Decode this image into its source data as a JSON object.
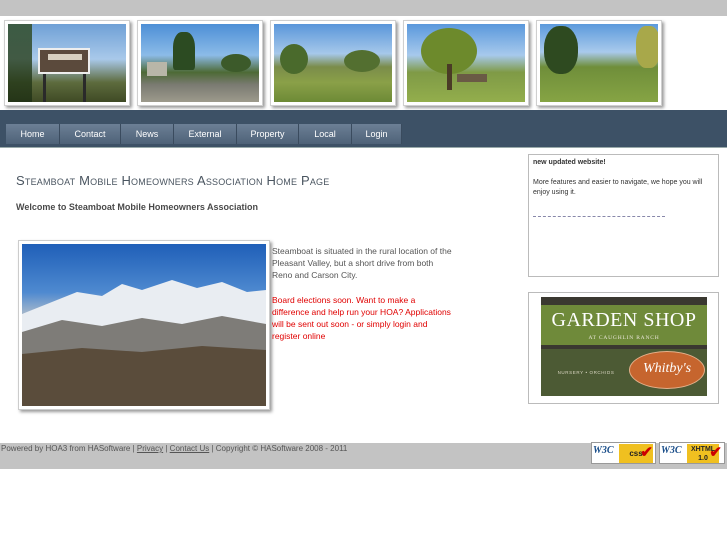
{
  "banner": {
    "photos": [
      {
        "name": "banner-photo-welcome-sign"
      },
      {
        "name": "banner-photo-street"
      },
      {
        "name": "banner-photo-park"
      },
      {
        "name": "banner-photo-tree"
      },
      {
        "name": "banner-photo-lawn"
      }
    ]
  },
  "nav": {
    "items": [
      {
        "label": "Home"
      },
      {
        "label": "Contact"
      },
      {
        "label": "News"
      },
      {
        "label": "External"
      },
      {
        "label": "Property"
      },
      {
        "label": "Local"
      },
      {
        "label": "Login"
      }
    ]
  },
  "main": {
    "title": "Steamboat Mobile Homeowners Association Home Page",
    "welcome": "Welcome to Steamboat Mobile Homeowners Association",
    "intro": "Steamboat is situated in the rural location of the Pleasant Valley, but a short drive from both Reno and Carson City.",
    "notice": "Board elections soon. Want to make a difference and help run your HOA? Applications will be sent out soon - or simply login and register online"
  },
  "sidebar": {
    "news_title": "new updated website!",
    "news_body": "More features and easier to navigate, we hope you will enjoy using it.",
    "ad": {
      "headline": "GARDEN SHOP",
      "subline": "AT CAUGHLIN RANCH",
      "brand": "Whitby's",
      "tagline": "NURSERY • ORCHIDS"
    }
  },
  "footer": {
    "prefix": "Powered by HOA3 from HASoftware | ",
    "privacy": "Privacy",
    "sep": " | ",
    "contact": "Contact Us",
    "copyright": " | Copyright © HASoftware 2008 - 2011"
  },
  "badges": {
    "css": {
      "w3": "W3C",
      "kind": "css"
    },
    "xhtml": {
      "w3": "W3C",
      "kind": "XHTML 1.0"
    }
  },
  "icons": {
    "check": "check-mark-icon"
  }
}
